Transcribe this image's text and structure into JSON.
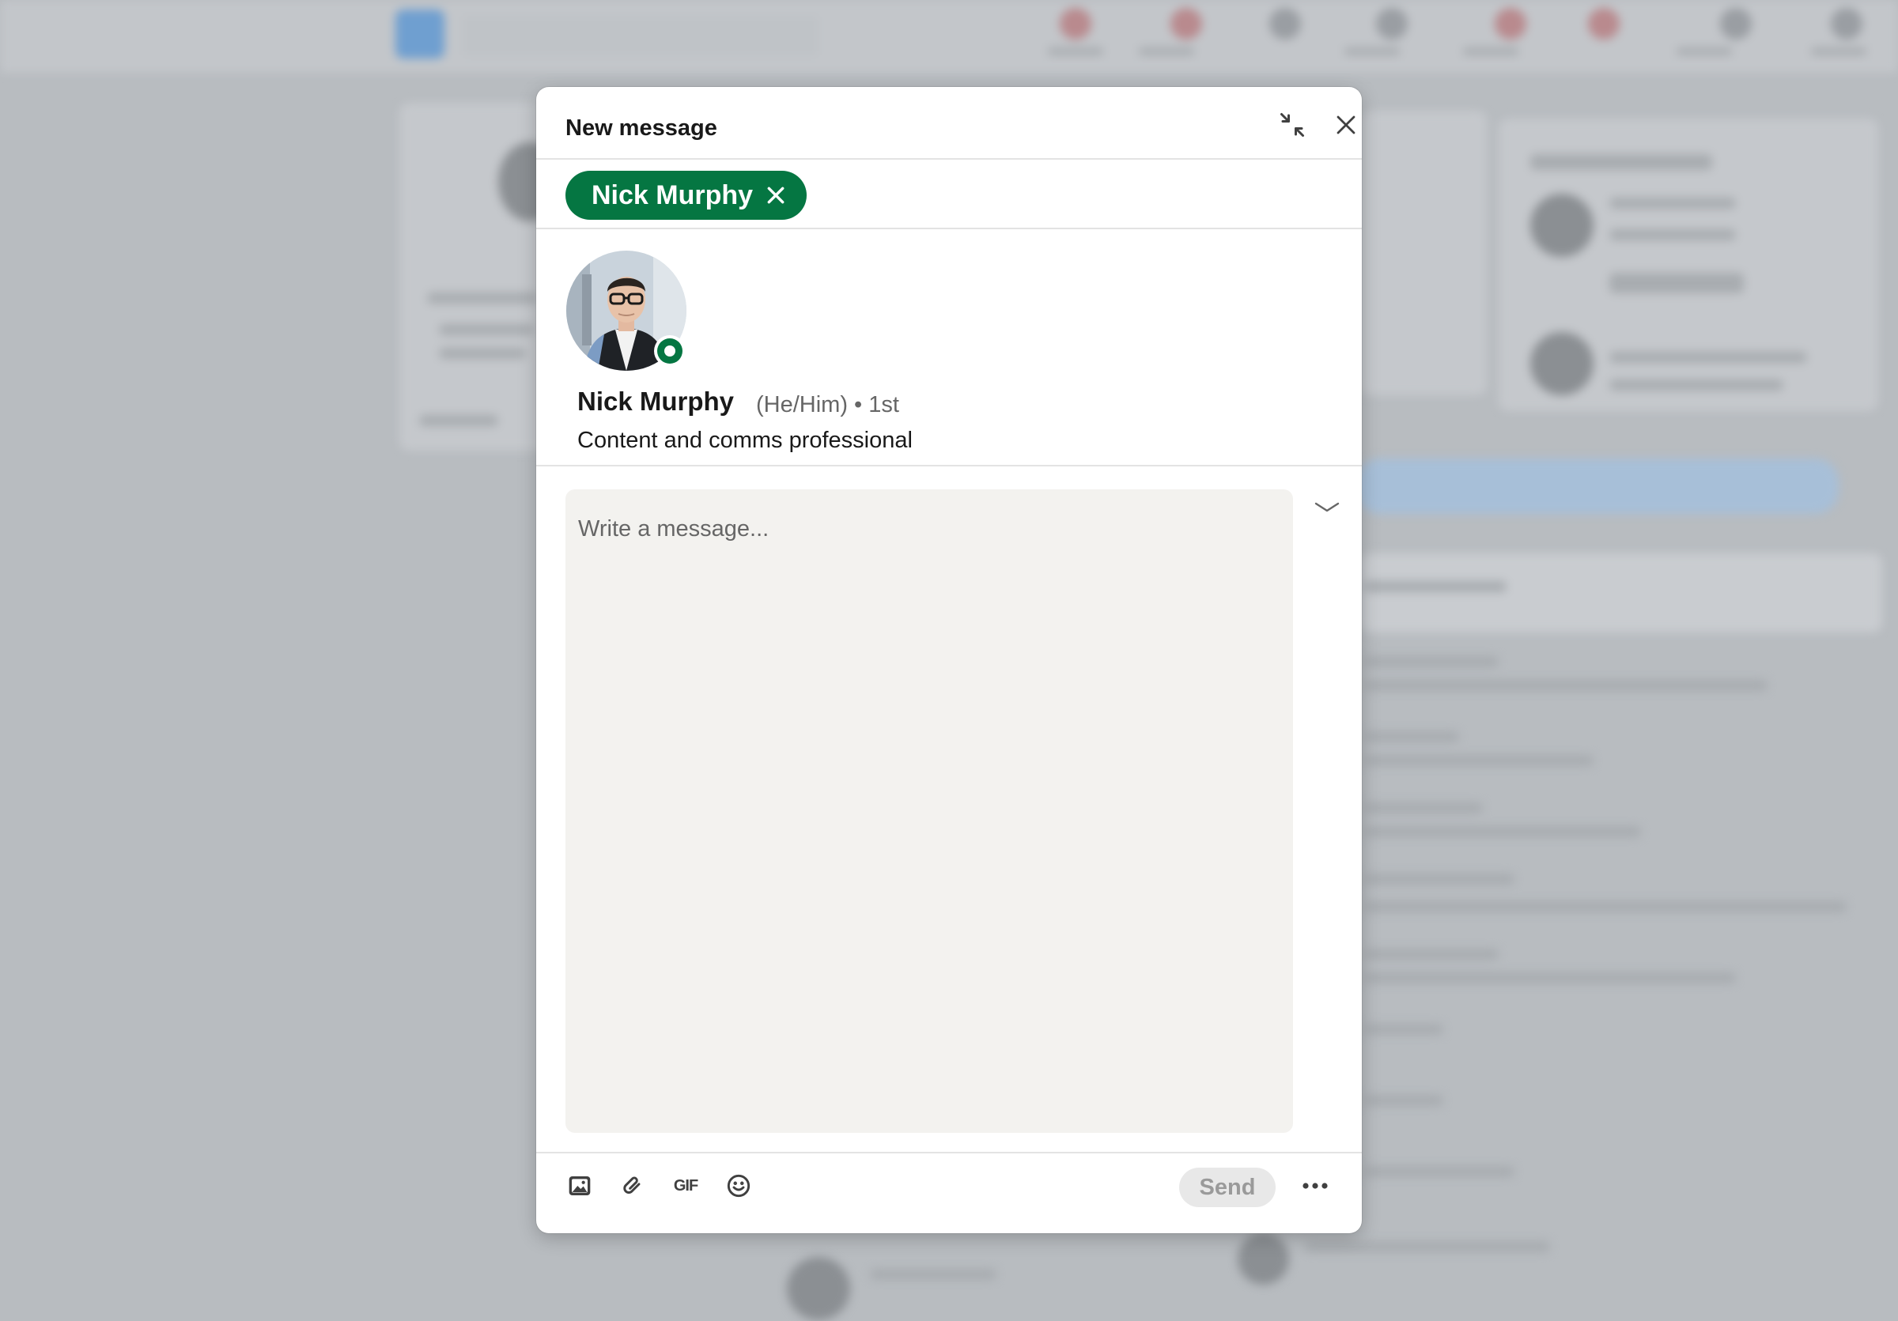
{
  "modal": {
    "title": "New message",
    "minimize_icon": "minimize-arrows-icon",
    "close_icon": "close-icon"
  },
  "recipients": [
    {
      "name": "Nick Murphy",
      "remove_icon": "remove-x-icon"
    }
  ],
  "profile": {
    "name": "Nick Murphy",
    "meta": "(He/Him) • 1st",
    "headline": "Content and comms professional",
    "presence": "online"
  },
  "composer": {
    "placeholder": "Write a message...",
    "expand_icon": "chevron-down-icon"
  },
  "toolbar": {
    "image_icon": "image-icon",
    "attach_icon": "paperclip-icon",
    "gif_label": "GIF",
    "emoji_icon": "emoji-icon",
    "send_label": "Send",
    "more_icon": "ellipsis-icon"
  },
  "colors": {
    "brand_green": "#057642",
    "send_disabled_bg": "#e8e8e8",
    "composer_bg": "#f3f2ef"
  }
}
